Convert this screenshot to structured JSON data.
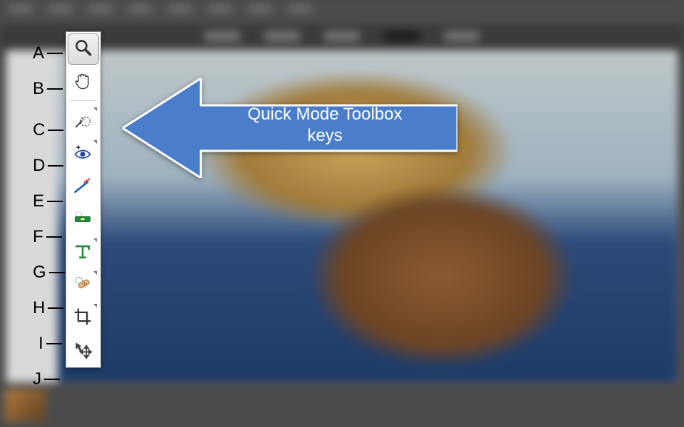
{
  "callout": {
    "line1": "Quick Mode Toolbox",
    "line2": "keys",
    "fill": "#4a7ecb",
    "stroke": "#ffffff"
  },
  "tools": [
    {
      "key": "A",
      "name": "zoom-tool",
      "icon": "magnifier-icon",
      "selected": true
    },
    {
      "key": "B",
      "name": "hand-tool",
      "icon": "hand-icon",
      "selected": false
    },
    {
      "key": "C",
      "name": "quick-selection-tool",
      "icon": "wand-select-icon",
      "selected": false
    },
    {
      "key": "D",
      "name": "red-eye-tool",
      "icon": "eye-plus-icon",
      "selected": false
    },
    {
      "key": "E",
      "name": "whiten-teeth-tool",
      "icon": "toothbrush-icon",
      "selected": false
    },
    {
      "key": "F",
      "name": "straighten-tool",
      "icon": "level-icon",
      "selected": false
    },
    {
      "key": "G",
      "name": "type-tool",
      "icon": "type-icon",
      "selected": false
    },
    {
      "key": "H",
      "name": "spot-heal-tool",
      "icon": "bandage-icon",
      "selected": false
    },
    {
      "key": "I",
      "name": "crop-tool",
      "icon": "crop-icon",
      "selected": false
    },
    {
      "key": "J",
      "name": "move-tool",
      "icon": "move-icon",
      "selected": false
    }
  ]
}
